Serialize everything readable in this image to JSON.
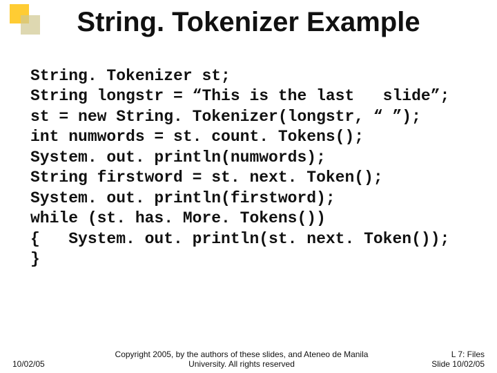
{
  "title": "String. Tokenizer Example",
  "code": "String. Tokenizer st;\nString longstr = “This is the last   slide”;\nst = new String. Tokenizer(longstr, “ ”);\nint numwords = st. count. Tokens();\nSystem. out. println(numwords);\nString firstword = st. next. Token();\nSystem. out. println(firstword);\nwhile (st. has. More. Tokens())\n{   System. out. println(st. next. Token());\n}",
  "footer": {
    "left": "10/02/05",
    "center": "Copyright 2005, by the authors of these slides, and Ateneo de Manila University. All rights reserved",
    "right_line1": "L 7: Files",
    "right_line2": "Slide 10/02/05"
  }
}
